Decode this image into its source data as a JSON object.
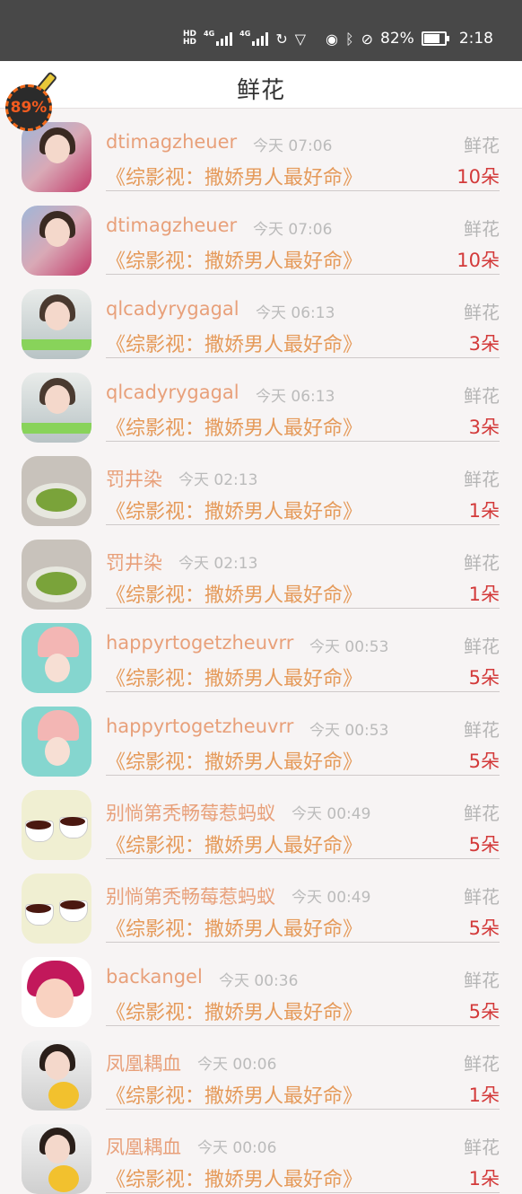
{
  "status_bar": {
    "network": "4G",
    "hd": "HD",
    "battery": "82%",
    "time": "2:18",
    "icons": [
      "hd-icon",
      "signal-icon",
      "data-icon",
      "shield-icon",
      "eye-icon",
      "bluetooth-icon",
      "mute-icon",
      "battery-icon"
    ]
  },
  "header": {
    "title": "鲜花"
  },
  "boost_widget": {
    "percent": "89%"
  },
  "colors": {
    "username": "#e8a07a",
    "book": "#e59a5a",
    "count": "#d33a3a",
    "muted": "#bbbbbb"
  },
  "records": [
    {
      "user": "dtimagzheuer",
      "time": "今天 07:06",
      "type": "鲜花",
      "book": "《综影视：撒娇男人最好命》",
      "count": "10朵",
      "avatar": "girl-photo"
    },
    {
      "user": "dtimagzheuer",
      "time": "今天 07:06",
      "type": "鲜花",
      "book": "《综影视：撒娇男人最好命》",
      "count": "10朵",
      "avatar": "girl-photo"
    },
    {
      "user": "qlcadyrygagal",
      "time": "今天 06:13",
      "type": "鲜花",
      "book": "《综影视：撒娇男人最好命》",
      "count": "3朵",
      "avatar": "boy-photo"
    },
    {
      "user": "qlcadyrygagal",
      "time": "今天 06:13",
      "type": "鲜花",
      "book": "《综影视：撒娇男人最好命》",
      "count": "3朵",
      "avatar": "boy-photo"
    },
    {
      "user": "罚井染",
      "time": "今天 02:13",
      "type": "鲜花",
      "book": "《综影视：撒娇男人最好命》",
      "count": "1朵",
      "avatar": "food-photo"
    },
    {
      "user": "罚井染",
      "time": "今天 02:13",
      "type": "鲜花",
      "book": "《综影视：撒娇男人最好命》",
      "count": "1朵",
      "avatar": "food-photo"
    },
    {
      "user": "happyrtogetzheuvrr",
      "time": "今天 00:53",
      "type": "鲜花",
      "book": "《综影视：撒娇男人最好命》",
      "count": "5朵",
      "avatar": "hat-photo"
    },
    {
      "user": "happyrtogetzheuvrr",
      "time": "今天 00:53",
      "type": "鲜花",
      "book": "《综影视：撒娇男人最好命》",
      "count": "5朵",
      "avatar": "hat-photo"
    },
    {
      "user": "别惝第秃畅莓惹蚂蚁",
      "time": "今天 00:49",
      "type": "鲜花",
      "book": "《综影视：撒娇男人最好命》",
      "count": "5朵",
      "avatar": "tea-photo"
    },
    {
      "user": "别惝第秃畅莓惹蚂蚁",
      "time": "今天 00:49",
      "type": "鲜花",
      "book": "《综影视：撒娇男人最好命》",
      "count": "5朵",
      "avatar": "tea-photo"
    },
    {
      "user": "backangel",
      "time": "今天 00:36",
      "type": "鲜花",
      "book": "《综影视：撒娇男人最好命》",
      "count": "5朵",
      "avatar": "cartoon-avatar"
    },
    {
      "user": "凤凰耦血",
      "time": "今天 00:06",
      "type": "鲜花",
      "book": "《综影视：撒娇男人最好命》",
      "count": "1朵",
      "avatar": "child-photo"
    },
    {
      "user": "凤凰耦血",
      "time": "今天 00:06",
      "type": "鲜花",
      "book": "《综影视：撒娇男人最好命》",
      "count": "1朵",
      "avatar": "child-photo"
    }
  ]
}
